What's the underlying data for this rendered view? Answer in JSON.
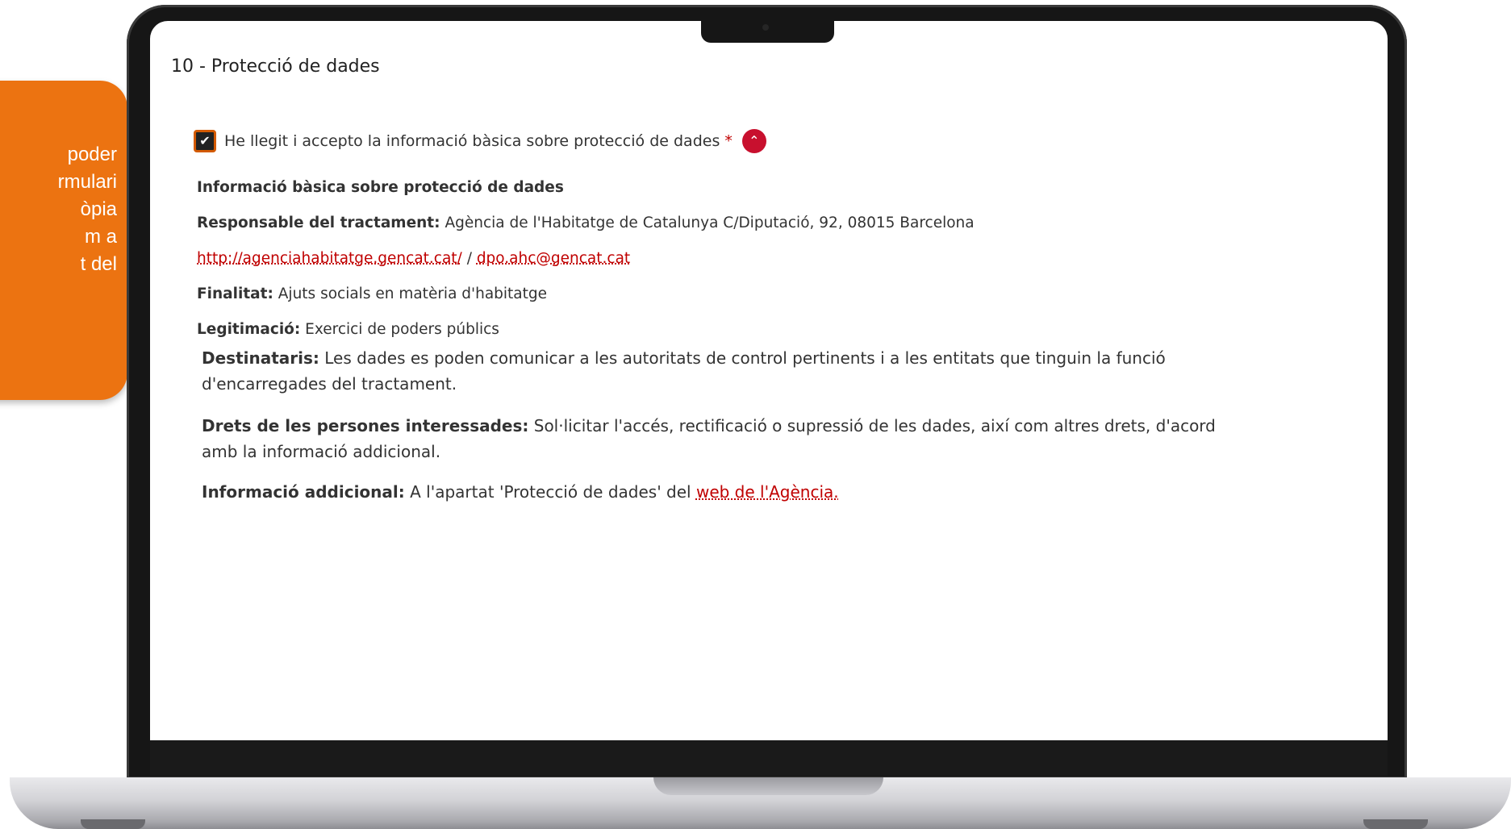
{
  "callout": {
    "lines": [
      "poder",
      "rmulari",
      "òpia",
      "m a",
      "t del"
    ],
    "color": "#ec7311"
  },
  "form": {
    "section_title": "10 - Protecció de dades",
    "consent": {
      "label": "He llegit i accepto la informació bàsica sobre protecció de dades",
      "required_mark": "*",
      "checked": true,
      "check_glyph": "✔",
      "toggle_icon": "chevron-up-icon",
      "toggle_glyph": "⌃"
    },
    "info": {
      "heading": "Informació bàsica sobre protecció de dades",
      "responsable_label": "Responsable del tractament:",
      "responsable_text": "Agència de l'Habitatge de Catalunya C/Diputació, 92, 08015 Barcelona",
      "website_link": "http://agenciahabitatge.gencat.cat/",
      "separator": "/",
      "email_link": "dpo.ahc@gencat.cat",
      "finalitat_label": "Finalitat:",
      "finalitat_text": "Ajuts socials en matèria d'habitatge",
      "legitimacio_label": "Legitimació:",
      "legitimacio_text": "Exercici de poders públics",
      "destinataris_label": "Destinataris:",
      "destinataris_text": "Les dades es poden comunicar a les autoritats de control pertinents i a les entitats que tinguin la funció d'encarregades del tractament.",
      "drets_label": "Drets de les persones interessades:",
      "drets_text": "Sol·licitar l'accés, rectificació o supressió de les dades, així com altres drets, d'acord amb la informació addicional.",
      "addicional_label": "Informació addicional:",
      "addicional_text": "A l'apartat 'Protecció de dades' del",
      "addicional_link": "web de l'Agència."
    }
  },
  "colors": {
    "accent_red": "#c8102e",
    "link_red": "#c00000",
    "checkbox_border": "#d35a00"
  }
}
